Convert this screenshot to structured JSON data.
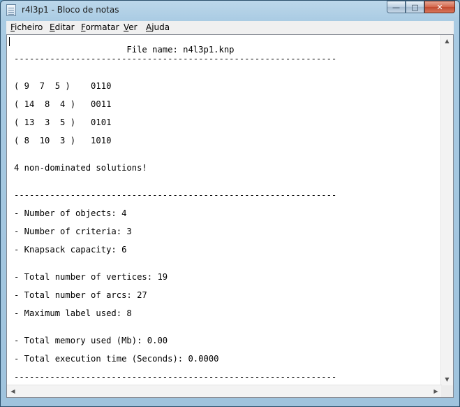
{
  "window": {
    "title": "r4l3p1 - Bloco de notas",
    "controls": {
      "minimize": "—",
      "maximize": "□",
      "close": "✕"
    }
  },
  "menubar": {
    "items": [
      {
        "label_ul": "F",
        "label_rest": "icheiro"
      },
      {
        "label_ul": "E",
        "label_rest": "ditar"
      },
      {
        "label_ul": "F",
        "label_rest": "ormatar"
      },
      {
        "label_ul": "V",
        "label_rest": "er"
      },
      {
        "label_ul": "A",
        "label_rest": "juda"
      }
    ]
  },
  "document": {
    "lines": [
      "                      File name: n4l3p1.knp",
      "---------------------------------------------------------------",
      "( 9  7  5 )    0110",
      "( 14  8  4 )   0011",
      "( 13  3  5 )   0101",
      "( 8  10  3 )   1010",
      "4 non-dominated solutions!",
      "---------------------------------------------------------------",
      "- Number of objects: 4",
      "- Number of criteria: 3",
      "- Knapsack capacity: 6",
      "- Total number of vertices: 19",
      "- Total number of arcs: 27",
      "- Maximum label used: 8",
      "- Total memory used (Mb): 0.00",
      "- Total execution time (Seconds): 0.0000",
      "---------------------------------------------------------------"
    ]
  },
  "scrollbars": {
    "up": "▲",
    "down": "▼",
    "left": "◀",
    "right": "▶"
  }
}
